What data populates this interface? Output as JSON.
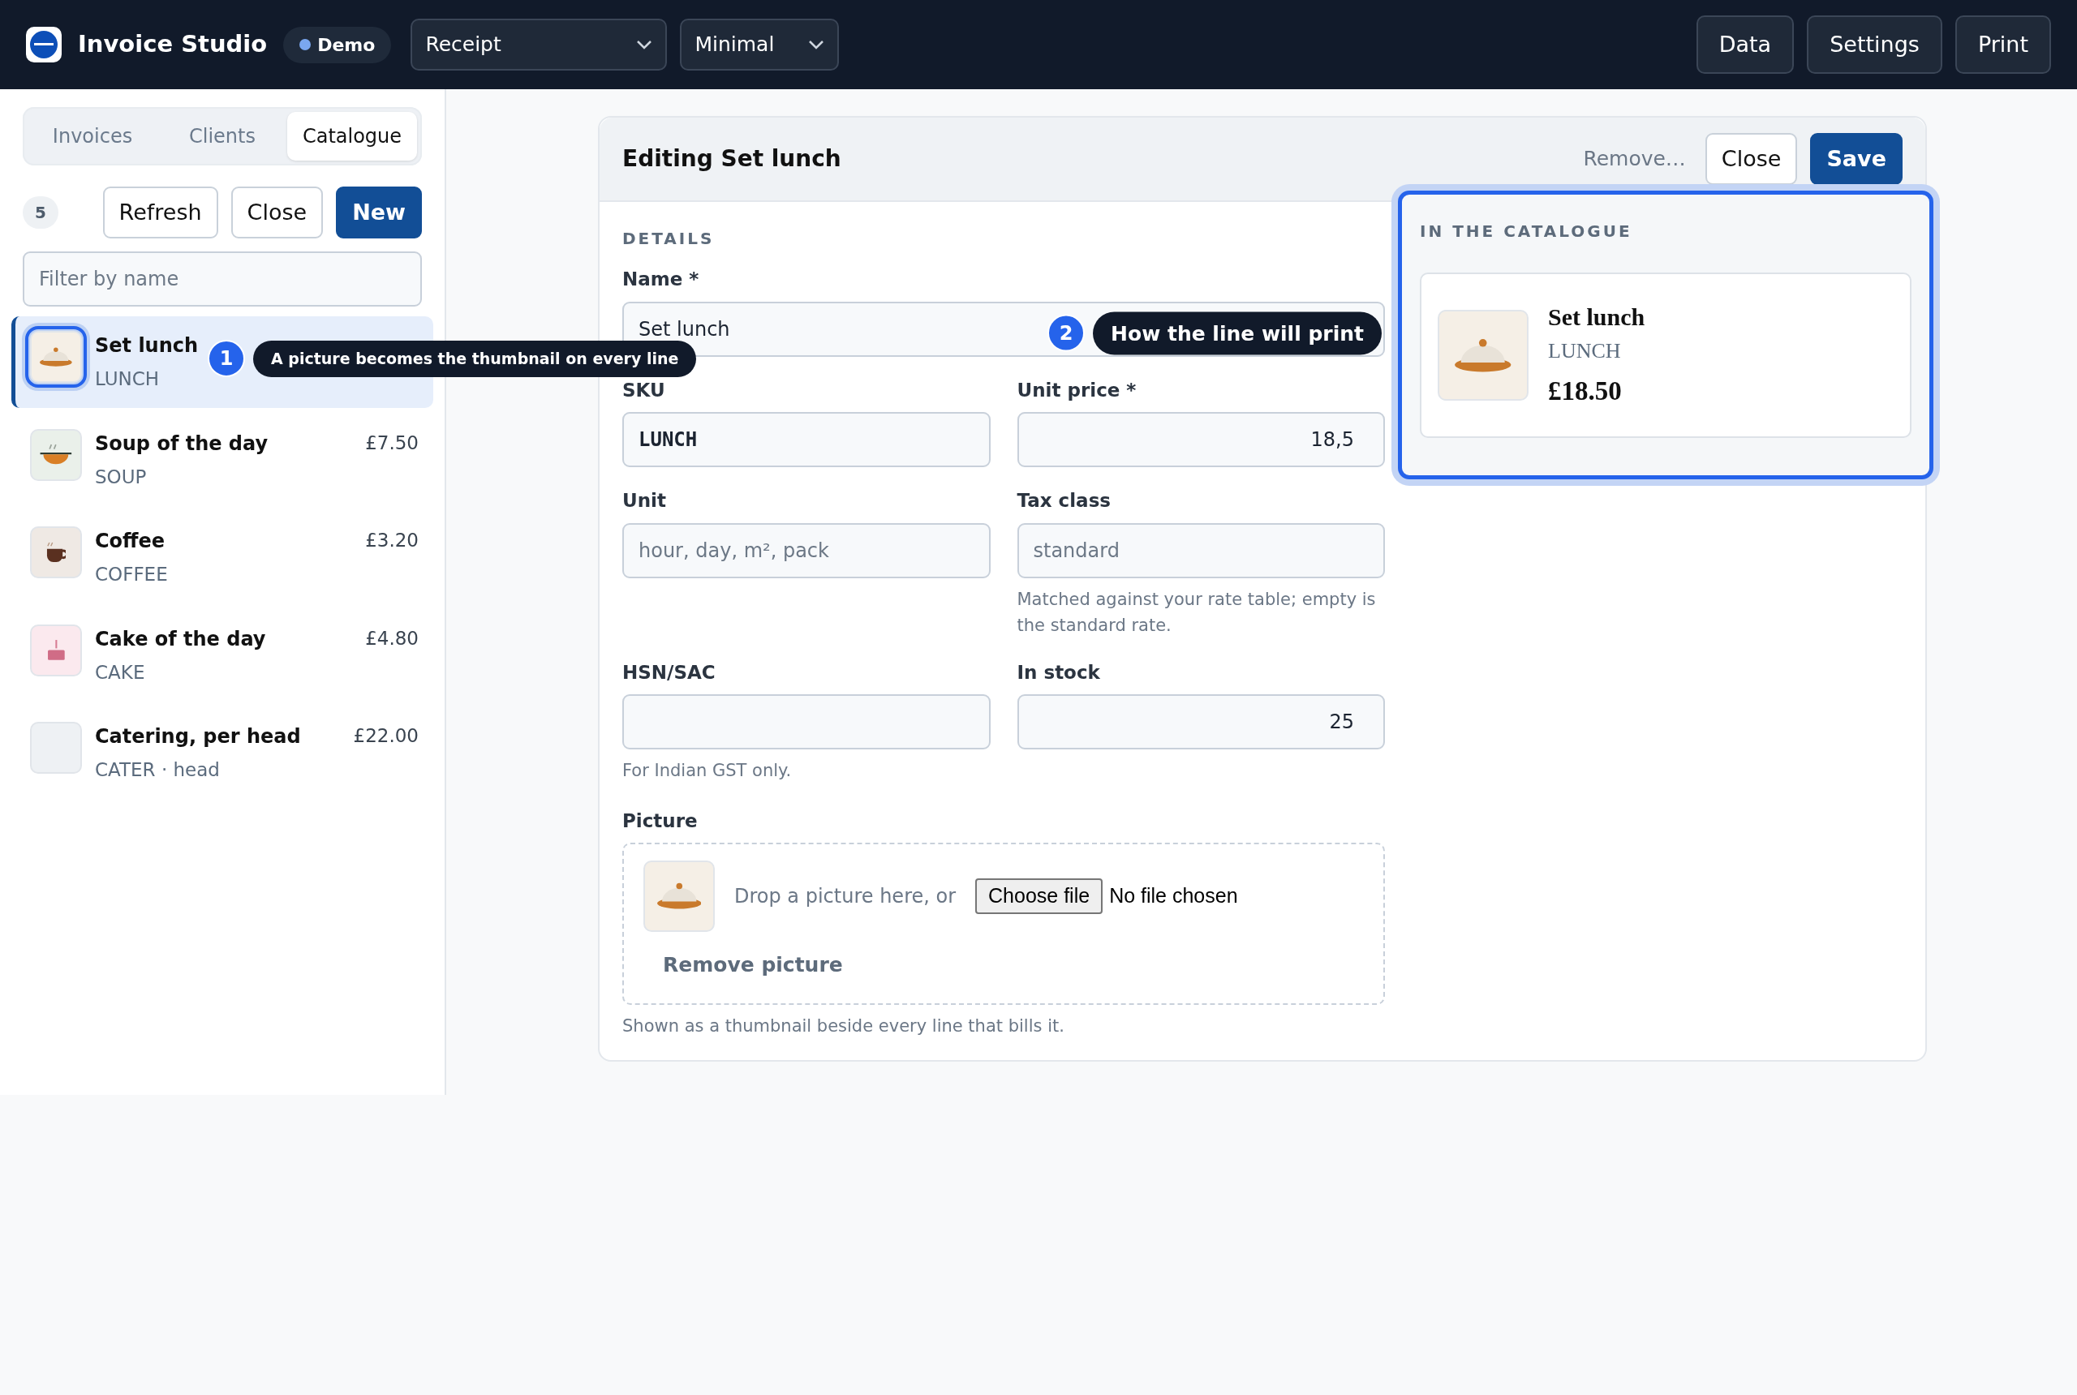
{
  "app": {
    "title": "Invoice Studio",
    "badge": "Demo"
  },
  "selects": [
    {
      "value": "Receipt"
    },
    {
      "value": "Minimal"
    }
  ],
  "actions": [
    "Data",
    "Settings",
    "Print"
  ],
  "sidebar": {
    "tabs": [
      {
        "label": "Invoices",
        "selected": false
      },
      {
        "label": "Clients",
        "selected": false
      },
      {
        "label": "Catalogue",
        "selected": true
      }
    ],
    "count": "5",
    "buttons": [
      {
        "label": "Refresh",
        "kind": "outline"
      },
      {
        "label": "Close",
        "kind": "outline"
      },
      {
        "label": "New",
        "kind": "primary"
      }
    ],
    "filter": {
      "placeholder": "Filter by name"
    },
    "items": [
      {
        "name": "Set lunch",
        "sku": "LUNCH",
        "thumb": {
          "kind": "cloche"
        },
        "selected": true
      },
      {
        "name": "Soup of the day",
        "sku": "SOUP",
        "price": "£7.50",
        "thumb": {
          "kind": "bowl"
        },
        "selected": false
      },
      {
        "name": "Coffee",
        "sku": "COFFEE",
        "price": "£3.20",
        "thumb": {
          "kind": "cup"
        },
        "selected": false
      },
      {
        "name": "Cake of the day",
        "sku": "CAKE",
        "price": "£4.80",
        "thumb": {
          "kind": "cake"
        },
        "selected": false
      },
      {
        "name": "Catering, per head",
        "sku": "CATER · head",
        "price": "£22.00",
        "thumb": {
          "kind": "none"
        },
        "selected": false
      }
    ]
  },
  "editor": {
    "title": "Editing Set lunch",
    "remove": "Remove…",
    "buttons": [
      {
        "label": "Close",
        "kind": "outline"
      },
      {
        "label": "Save",
        "kind": "primary"
      }
    ],
    "section": "DETAILS",
    "rows": [
      [
        {
          "label": "Name *",
          "value": "Set lunch",
          "kind": "text"
        }
      ],
      [
        {
          "label": "SKU",
          "value": "LUNCH",
          "kind": "code"
        },
        {
          "label": "Unit price *",
          "value": "18,5",
          "kind": "number"
        }
      ],
      [
        {
          "label": "Unit",
          "placeholder": "hour, day, m², pack",
          "kind": "text"
        },
        {
          "label": "Tax class",
          "placeholder": "standard",
          "kind": "text",
          "help": "Matched against your rate table; empty is the standard rate."
        }
      ],
      [
        {
          "label": "HSN/SAC",
          "kind": "text",
          "help": "For Indian GST only."
        },
        {
          "label": "In stock",
          "value": "25",
          "kind": "number"
        }
      ]
    ],
    "picture": {
      "label": "Picture",
      "thumb": {
        "kind": "cloche"
      },
      "hint": "Drop a picture here, or",
      "file_button": "Choose file",
      "file_status": "No file chosen",
      "remove": "Remove picture",
      "help": "Shown as a thumbnail beside every line that bills it."
    }
  },
  "preview": {
    "heading": "IN THE CATALOGUE",
    "name": "Set lunch",
    "sku": "LUNCH",
    "price": "£18.50",
    "thumb": {
      "kind": "cloche"
    }
  },
  "tour": [
    {
      "number": "1",
      "text": "A picture becomes the thumbnail on every line"
    },
    {
      "number": "2",
      "text": "How the line will print"
    }
  ]
}
